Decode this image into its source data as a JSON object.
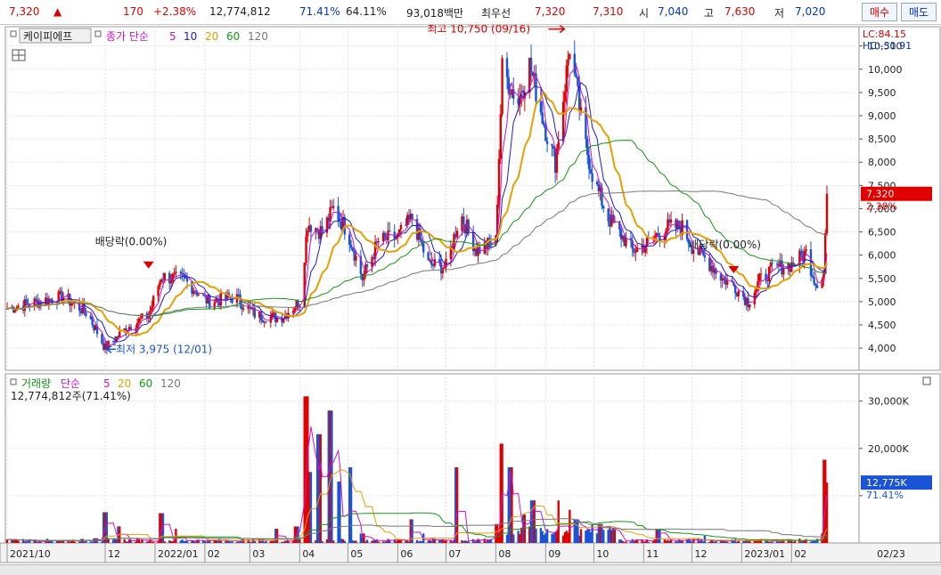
{
  "header": {
    "price": "7,320",
    "arrow": "▲",
    "change": "170",
    "change_pct": "+2.38%",
    "volume": "12,774,812",
    "vol_ratio": "71.41%",
    "rate2": "64.11%",
    "mktcap": "93,018백만",
    "best_label": "최우선",
    "ask": "7,320",
    "bid": "7,310",
    "open_label": "시",
    "open": "7,040",
    "high_label": "고",
    "high": "7,630",
    "low_label": "저",
    "low": "7,020",
    "buy_label": "매수",
    "sell_label": "매도"
  },
  "colors": {
    "up": "#e00000",
    "down": "#1a53d6",
    "ma5": "#d010d0",
    "ma10": "#1a1ad8",
    "ma20": "#e8a000",
    "ma60": "#119911",
    "ma120": "#777777"
  },
  "chart_data": {
    "type": "candlestick",
    "price_panel": {
      "legend": {
        "name": "케이피에프",
        "item": "종가",
        "method": "단순",
        "periods": [
          "5",
          "10",
          "20",
          "60",
          "120"
        ]
      },
      "ylim": [
        3600,
        10800
      ],
      "yticks": [
        4000,
        4500,
        5000,
        5500,
        6000,
        6500,
        7000,
        7500,
        8000,
        8500,
        9000,
        9500,
        10000,
        10500
      ],
      "ytick_labels": [
        "4,000",
        "4,500",
        "5,000",
        "5,500",
        "6,000",
        "6,500",
        "7,000",
        "7,500",
        "8,000",
        "8,500",
        "9,000",
        "9,500",
        "10,000",
        "10,500"
      ],
      "lc_label": "LC:84.15",
      "hc_label": "HC:-31.91",
      "current_price_label": "7,320",
      "current_pct_label": "2.38%",
      "annotations": {
        "high": "최고 10,750 (09/16)",
        "low": "최저 3,975 (12/01)",
        "dividend1": "배당락(0.00%)",
        "dividend2": "배당락(0.00%)"
      },
      "keypoints": [
        [
          "2021-10-01",
          4850
        ],
        [
          "2021-10-20",
          5000
        ],
        [
          "2021-11-05",
          5100
        ],
        [
          "2021-11-20",
          4750
        ],
        [
          "2021-12-01",
          4000
        ],
        [
          "2021-12-15",
          4450
        ],
        [
          "2021-12-28",
          4700
        ],
        [
          "2022-01-05",
          5550
        ],
        [
          "2022-01-20",
          5450
        ],
        [
          "2022-02-03",
          5000
        ],
        [
          "2022-02-20",
          5100
        ],
        [
          "2022-03-05",
          4700
        ],
        [
          "2022-03-20",
          4650
        ],
        [
          "2022-04-01",
          5000
        ],
        [
          "2022-04-06",
          6700
        ],
        [
          "2022-04-15",
          6500
        ],
        [
          "2022-04-22",
          7000
        ],
        [
          "2022-05-01",
          6500
        ],
        [
          "2022-05-10",
          5500
        ],
        [
          "2022-05-20",
          6300
        ],
        [
          "2022-06-01",
          6400
        ],
        [
          "2022-06-10",
          6800
        ],
        [
          "2022-06-20",
          5800
        ],
        [
          "2022-07-01",
          5750
        ],
        [
          "2022-07-10",
          6900
        ],
        [
          "2022-07-20",
          6100
        ],
        [
          "2022-08-01",
          6300
        ],
        [
          "2022-08-05",
          10000
        ],
        [
          "2022-08-15",
          9300
        ],
        [
          "2022-08-22",
          10100
        ],
        [
          "2022-09-01",
          8700
        ],
        [
          "2022-09-07",
          8000
        ],
        [
          "2022-09-16",
          10500
        ],
        [
          "2022-09-25",
          8500
        ],
        [
          "2022-10-01",
          7600
        ],
        [
          "2022-10-10",
          6800
        ],
        [
          "2022-10-25",
          6100
        ],
        [
          "2022-11-01",
          6200
        ],
        [
          "2022-11-15",
          6600
        ],
        [
          "2022-11-25",
          6600
        ],
        [
          "2022-12-01",
          6200
        ],
        [
          "2022-12-10",
          5900
        ],
        [
          "2022-12-20",
          5500
        ],
        [
          "2022-12-27",
          5350
        ],
        [
          "2023-01-05",
          5000
        ],
        [
          "2023-01-12",
          5450
        ],
        [
          "2023-01-20",
          5700
        ],
        [
          "2023-02-01",
          5800
        ],
        [
          "2023-02-10",
          6050
        ],
        [
          "2023-02-16",
          5400
        ],
        [
          "2023-02-21",
          5600
        ],
        [
          "2023-02-23",
          7320
        ]
      ]
    },
    "volume_panel": {
      "legend": {
        "name": "거래량",
        "method": "단순",
        "periods": [
          "5",
          "20",
          "60",
          "120"
        ]
      },
      "current_label": "12,774,812주(71.41%)",
      "ylim": [
        0,
        32000
      ],
      "yticks": [
        10000,
        20000,
        30000
      ],
      "ytick_labels": [
        "",
        "20,000K",
        "30,000K"
      ],
      "current_tag": "12,775K",
      "current_tag_pct": "71.41%",
      "spikes": [
        [
          "2021-10-05",
          700
        ],
        [
          "2021-11-25",
          1000
        ],
        [
          "2021-12-01",
          6500
        ],
        [
          "2021-12-10",
          3500
        ],
        [
          "2022-01-05",
          6300
        ],
        [
          "2022-01-15",
          3000
        ],
        [
          "2022-03-18",
          3000
        ],
        [
          "2022-03-30",
          3500
        ],
        [
          "2022-04-05",
          31000
        ],
        [
          "2022-04-07",
          15000
        ],
        [
          "2022-04-13",
          23000
        ],
        [
          "2022-04-20",
          28000
        ],
        [
          "2022-04-25",
          13000
        ],
        [
          "2022-05-02",
          16000
        ],
        [
          "2022-05-10",
          2000
        ],
        [
          "2022-06-10",
          5000
        ],
        [
          "2022-06-18",
          2000
        ],
        [
          "2022-07-08",
          16000
        ],
        [
          "2022-08-01",
          4000
        ],
        [
          "2022-08-05",
          21000
        ],
        [
          "2022-08-10",
          16000
        ],
        [
          "2022-08-19",
          6000
        ],
        [
          "2022-08-24",
          9000
        ],
        [
          "2022-09-10",
          9000
        ],
        [
          "2022-09-17",
          7000
        ],
        [
          "2022-09-20",
          5000
        ],
        [
          "2022-10-05",
          4000
        ],
        [
          "2022-11-10",
          3000
        ],
        [
          "2022-12-10",
          1500
        ],
        [
          "2023-02-21",
          2000
        ],
        [
          "2023-02-22",
          17600
        ],
        [
          "2023-02-23",
          12775
        ]
      ]
    },
    "x_axis": {
      "labels": [
        "2021/10",
        "12",
        "2022/01",
        "02",
        "03",
        "04",
        "05",
        "06",
        "07",
        "08",
        "09",
        "10",
        "11",
        "12",
        "2023/01",
        "02",
        "02/23"
      ]
    }
  }
}
